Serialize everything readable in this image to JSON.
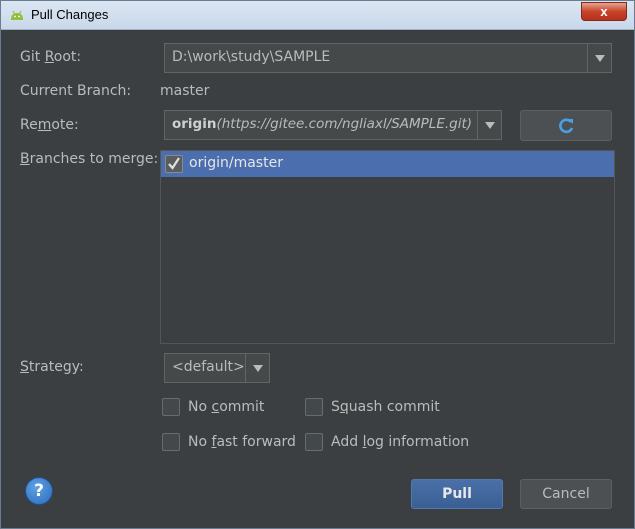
{
  "window": {
    "title": "Pull Changes",
    "close_label": "x"
  },
  "git_root": {
    "label_pre": "Git ",
    "label_mnemonic": "R",
    "label_post": "oot:",
    "value": "D:\\work\\study\\SAMPLE"
  },
  "current_branch": {
    "label": "Current Branch:",
    "value": "master"
  },
  "remote": {
    "label_pre": "Re",
    "label_mnemonic": "m",
    "label_post": "ote:",
    "name": "origin",
    "url": "(https://gitee.com/ngliaxl/SAMPLE.git)"
  },
  "branches": {
    "label_mnemonic": "B",
    "label_post": "ranches to merge:",
    "items": [
      {
        "label": "origin/master",
        "checked": true
      }
    ]
  },
  "strategy": {
    "label_mnemonic": "S",
    "label_post": "trategy:",
    "value": "<default>"
  },
  "options": {
    "no_commit": {
      "pre": "No ",
      "mnemonic": "c",
      "post": "ommit",
      "checked": false
    },
    "squash_commit": {
      "pre": "S",
      "mnemonic": "q",
      "post": "uash commit",
      "checked": false
    },
    "no_fast_forward": {
      "pre": "No ",
      "mnemonic": "f",
      "post": "ast forward",
      "checked": false
    },
    "add_log": {
      "pre": "Add ",
      "mnemonic": "l",
      "post": "og information",
      "checked": false
    }
  },
  "buttons": {
    "help": "?",
    "pull": "Pull",
    "cancel": "Cancel"
  },
  "colors": {
    "background": "#3c3f41",
    "selection": "#4b6eaf",
    "accent": "#3a5f94"
  },
  "icons": {
    "app": "android-icon",
    "refresh": "refresh-icon",
    "help": "help-icon",
    "check": "checkmark-icon"
  }
}
